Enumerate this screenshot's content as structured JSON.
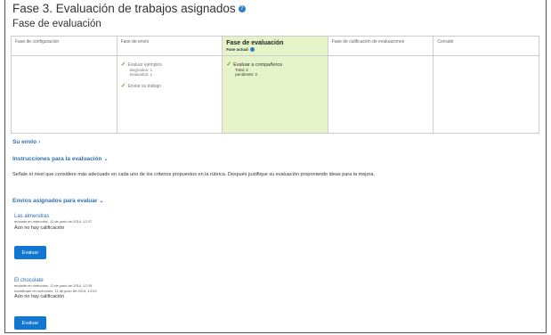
{
  "page": {
    "title": "Fase 3. Evaluación de trabajos asignados",
    "subtitle": "Fase de evaluación"
  },
  "phases": [
    {
      "label": "Fase de configuración",
      "tasks": []
    },
    {
      "label": "Fase de envío",
      "tasks": [
        {
          "label": "Evaluar ejemplos",
          "info1": "asignados: 1",
          "info2": "evaluados: 1"
        },
        {
          "label": "Enviar su trabajo"
        }
      ]
    },
    {
      "label": "Fase de evaluación",
      "current_label": "Fase actual",
      "active": true,
      "tasks": [
        {
          "label": "Evaluar a compañeros",
          "info1": "Total: 2",
          "info2": "pendiente: 2"
        }
      ]
    },
    {
      "label": "Fase de calificación de evaluaciones",
      "tasks": []
    },
    {
      "label": "Cerrado",
      "tasks": []
    }
  ],
  "sections": {
    "su_envio": "Su envío",
    "instrucciones": "Instrucciones para la evaluación",
    "instrucciones_text": "Señale el nivel que considere más adecuado en cada uno de los criterios propuestos en la rúbrica. Después justifique su evaluación proponiendo ideas para la mejora.",
    "envios": "Envíos asignados para evaluar"
  },
  "submissions": [
    {
      "title": "Las almendras",
      "meta1": "enviado en miércoles, 11 de junio de 2014, 12:37",
      "meta2": "",
      "grade": "Aún no hay calificación",
      "button": "Evaluar"
    },
    {
      "title": "El chocolate",
      "meta1": "enviado en miércoles, 11 de junio de 2014, 12:39",
      "meta2": "modificado en miércoles, 11 de junio de 2014, 13:03",
      "grade": "Aún no hay calificación",
      "button": "Evaluar"
    }
  ],
  "icons": {
    "help": "help-icon",
    "check": "check-icon",
    "current": "current-phase-dot-icon",
    "chevron": "chevron-icon"
  },
  "colors": {
    "accent": "#2f6fae",
    "active_phase": "#e6f2c8",
    "button": "#1177d1",
    "check": "#6aa32a"
  }
}
